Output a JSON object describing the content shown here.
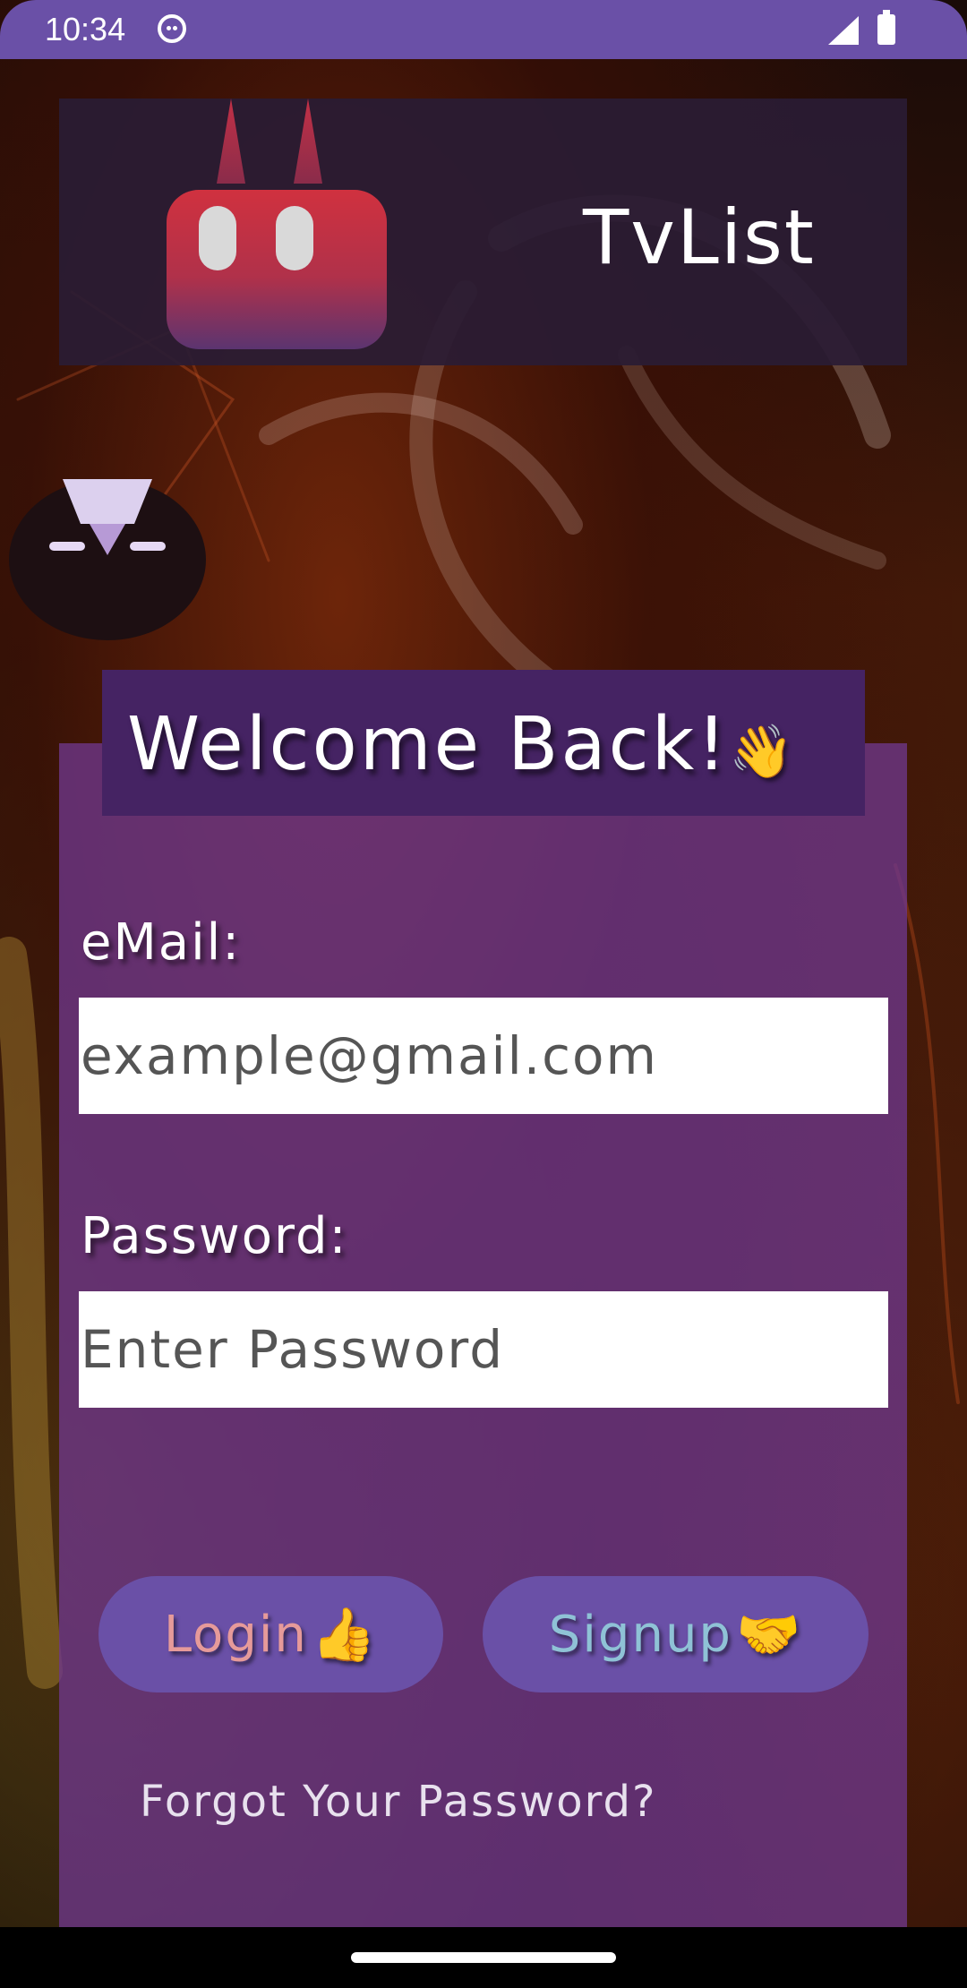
{
  "status_bar": {
    "time": "10:34",
    "icons": [
      "face-icon",
      "signal-icon",
      "battery-icon"
    ]
  },
  "header": {
    "app_title": "TvList",
    "logo_icon": "robot-devil-logo-icon"
  },
  "login": {
    "welcome_text": "Welcome Back!",
    "welcome_emoji": "👋",
    "email_label": "eMail:",
    "email_placeholder": "example@gmail.com",
    "email_value": "",
    "password_label": "Password:",
    "password_placeholder": "Enter Password",
    "password_value": "",
    "login_button_label": "Login",
    "login_button_emoji": "👍",
    "signup_button_label": "Signup",
    "signup_button_emoji": "🤝",
    "forgot_password_link": "Forgot Your Password?"
  },
  "colors": {
    "status_bar": "#6a50a7",
    "header_card": "#2a1c34",
    "welcome_banner": "#452363",
    "panel": "#6e378c",
    "button": "#6a50a7",
    "login_text": "#e69a9a",
    "signup_text": "#8fc2d6"
  }
}
